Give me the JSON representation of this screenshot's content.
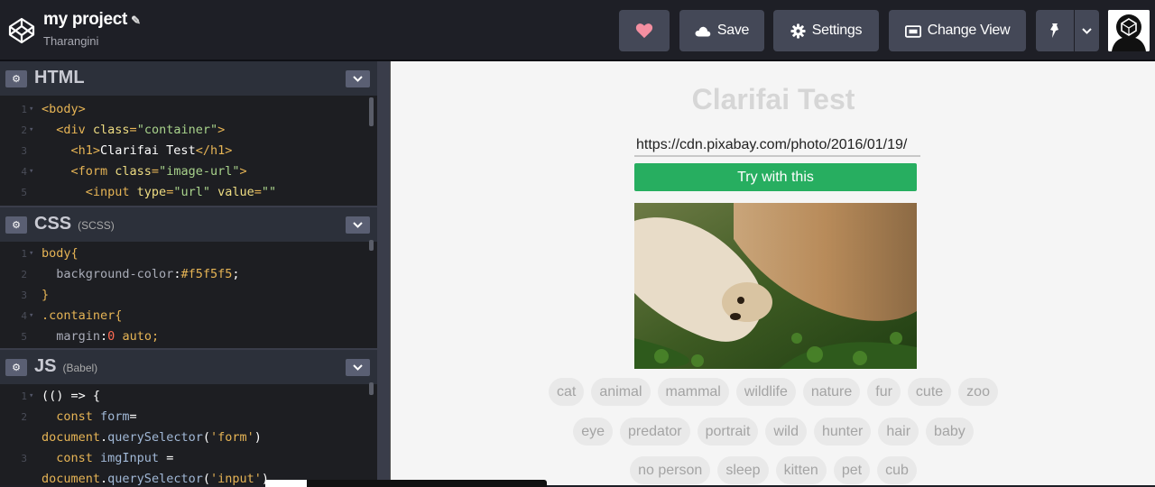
{
  "header": {
    "project_title": "my project",
    "user": "Tharangini",
    "save_label": "Save",
    "settings_label": "Settings",
    "change_view_label": "Change View"
  },
  "panes": [
    {
      "name": "HTML",
      "sub": "",
      "lines": [
        {
          "n": "1",
          "fold": "▾",
          "tokens": [
            {
              "t": "<body>",
              "c": "#e6b455"
            }
          ]
        },
        {
          "n": "2",
          "fold": "▾",
          "tokens": [
            {
              "t": "  <div ",
              "c": "#e6b455"
            },
            {
              "t": "class",
              "c": "#eedc82"
            },
            {
              "t": "=",
              "c": "#e6b455"
            },
            {
              "t": "\"container\"",
              "c": "#a8d28b"
            },
            {
              "t": ">",
              "c": "#e6b455"
            }
          ]
        },
        {
          "n": "3",
          "fold": "",
          "tokens": [
            {
              "t": "    <h1>",
              "c": "#e6b455"
            },
            {
              "t": "Clarifai Test",
              "c": "#ffffff"
            },
            {
              "t": "</h1>",
              "c": "#e6b455"
            }
          ]
        },
        {
          "n": "4",
          "fold": "▾",
          "tokens": [
            {
              "t": "    <form ",
              "c": "#e6b455"
            },
            {
              "t": "class",
              "c": "#eedc82"
            },
            {
              "t": "=",
              "c": "#e6b455"
            },
            {
              "t": "\"image-url\"",
              "c": "#a8d28b"
            },
            {
              "t": ">",
              "c": "#e6b455"
            }
          ]
        },
        {
          "n": "5",
          "fold": "",
          "tokens": [
            {
              "t": "      <input ",
              "c": "#e6b455"
            },
            {
              "t": "type",
              "c": "#eedc82"
            },
            {
              "t": "=",
              "c": "#e6b455"
            },
            {
              "t": "\"url\"",
              "c": "#a8d28b"
            },
            {
              "t": " value",
              "c": "#eedc82"
            },
            {
              "t": "=",
              "c": "#e6b455"
            },
            {
              "t": "\"\"",
              "c": "#a8d28b"
            }
          ]
        }
      ]
    },
    {
      "name": "CSS",
      "sub": "(SCSS)",
      "lines": [
        {
          "n": "1",
          "fold": "▾",
          "tokens": [
            {
              "t": "body{",
              "c": "#e6b455"
            }
          ]
        },
        {
          "n": "2",
          "fold": "",
          "tokens": [
            {
              "t": "  background-color",
              "c": "#a9acb8"
            },
            {
              "t": ":",
              "c": "#ffffff"
            },
            {
              "t": "#f5f5f5",
              "c": "#e6b455"
            },
            {
              "t": ";",
              "c": "#ffffff"
            }
          ]
        },
        {
          "n": "3",
          "fold": "",
          "tokens": [
            {
              "t": "}",
              "c": "#e6b455"
            }
          ]
        },
        {
          "n": "4",
          "fold": "▾",
          "tokens": [
            {
              "t": ".container{",
              "c": "#e6b455"
            }
          ]
        },
        {
          "n": "5",
          "fold": "",
          "tokens": [
            {
              "t": "  margin",
              "c": "#a9acb8"
            },
            {
              "t": ":",
              "c": "#ffffff"
            },
            {
              "t": "0",
              "c": "#ff6b53"
            },
            {
              "t": " auto;",
              "c": "#e6b455"
            }
          ]
        }
      ]
    },
    {
      "name": "JS",
      "sub": "(Babel)",
      "lines": [
        {
          "n": "1",
          "fold": "▾",
          "tokens": [
            {
              "t": "(() => {",
              "c": "#ffffff"
            }
          ]
        },
        {
          "n": "2",
          "fold": "",
          "tokens": [
            {
              "t": "  const ",
              "c": "#e6b455"
            },
            {
              "t": "form",
              "c": "#a1b8d6"
            },
            {
              "t": "=",
              "c": "#ffffff"
            }
          ]
        },
        {
          "n": "",
          "fold": "",
          "tokens": [
            {
              "t": "document",
              "c": "#e6b455"
            },
            {
              "t": ".",
              "c": "#ffffff"
            },
            {
              "t": "querySelector",
              "c": "#a1b8d6"
            },
            {
              "t": "(",
              "c": "#ffffff"
            },
            {
              "t": "'form'",
              "c": "#e6b455"
            },
            {
              "t": ")",
              "c": "#ffffff"
            }
          ]
        },
        {
          "n": "3",
          "fold": "",
          "tokens": [
            {
              "t": "  const ",
              "c": "#e6b455"
            },
            {
              "t": "imgInput",
              "c": "#a1b8d6"
            },
            {
              "t": " =",
              "c": "#ffffff"
            }
          ]
        },
        {
          "n": "",
          "fold": "",
          "tokens": [
            {
              "t": "document",
              "c": "#e6b455"
            },
            {
              "t": ".",
              "c": "#ffffff"
            },
            {
              "t": "querySelector",
              "c": "#a1b8d6"
            },
            {
              "t": "(",
              "c": "#ffffff"
            },
            {
              "t": "'input'",
              "c": "#e6b455"
            },
            {
              "t": ")",
              "c": "#ffffff"
            }
          ]
        }
      ]
    }
  ],
  "preview": {
    "title": "Clarifai Test",
    "url_value": "https://cdn.pixabay.com/photo/2016/01/19/",
    "button_label": "Try with this",
    "tag_rows": [
      [
        "cat",
        "animal",
        "mammal",
        "wildlife",
        "nature",
        "fur",
        "cute",
        "zoo"
      ],
      [
        "eye",
        "predator",
        "portrait",
        "wild",
        "hunter",
        "hair",
        "baby"
      ],
      [
        "no person",
        "sleep",
        "kitten",
        "pet",
        "cub"
      ]
    ]
  },
  "colors": {
    "topbar": "#1e1f26",
    "button": "#444857",
    "heart": "#f48fa1",
    "accent_green": "#27ae60"
  }
}
